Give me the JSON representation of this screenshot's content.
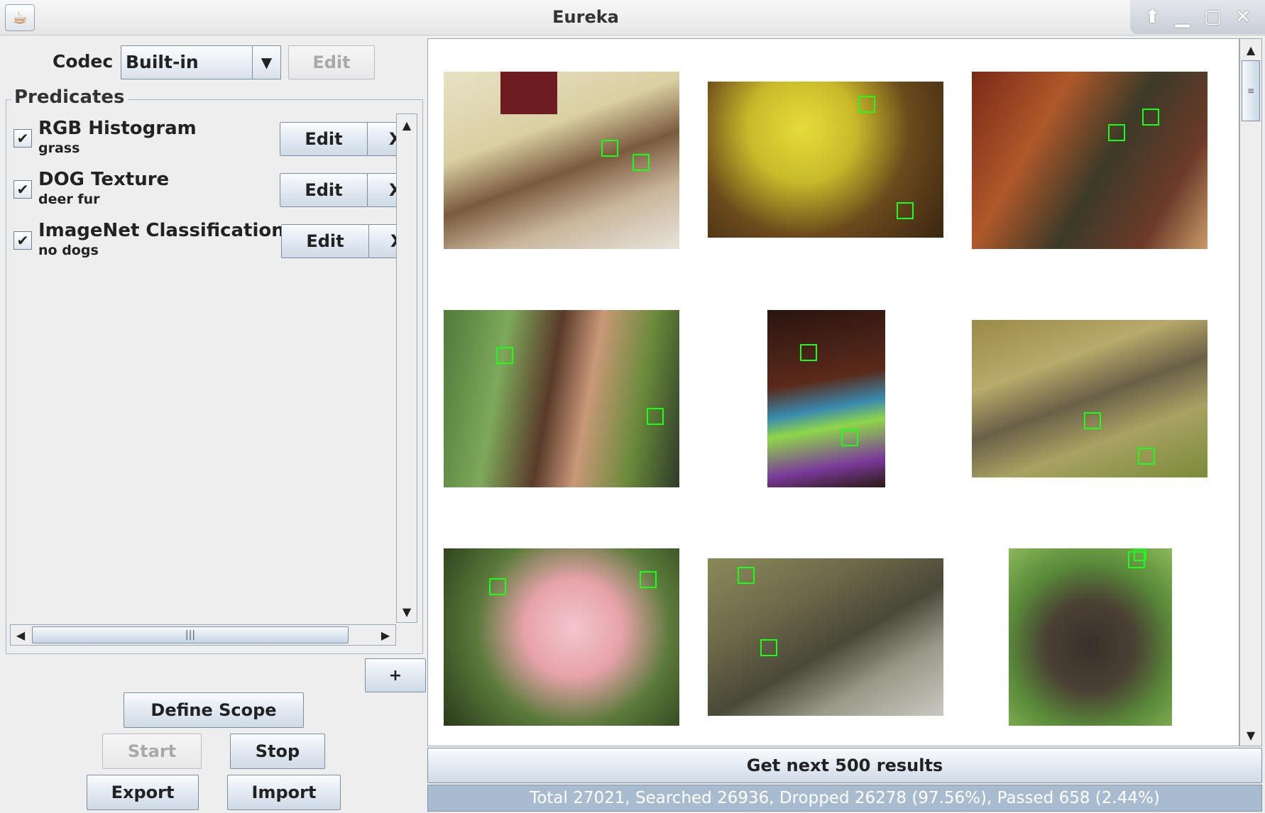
{
  "window": {
    "title": "Eureka",
    "app_icon": "java-cup-icon",
    "controls": [
      "arrow-up-icon",
      "minimize-icon",
      "maximize-icon",
      "close-icon"
    ]
  },
  "codec": {
    "label": "Codec",
    "selected": "Built-in",
    "edit_label": "Edit"
  },
  "predicates": {
    "title": "Predicates",
    "items": [
      {
        "name": "RGB Histogram",
        "sub": "grass",
        "checked": true,
        "edit_label": "Edit",
        "remove_label": "X"
      },
      {
        "name": "DOG Texture",
        "sub": "deer fur",
        "checked": true,
        "edit_label": "Edit",
        "remove_label": "X"
      },
      {
        "name": "ImageNet Classification",
        "sub": "no dogs",
        "checked": true,
        "edit_label": "Edit",
        "remove_label": "X"
      }
    ],
    "add_label": "+"
  },
  "actions": {
    "define_scope": "Define Scope",
    "start": "Start",
    "stop": "Stop",
    "export": "Export",
    "import": "Import"
  },
  "results": {
    "next_label": "Get next 500 results",
    "status": "Total 27021, Searched 26936, Dropped 26278 (97.56%), Passed 658 (2.44%)"
  },
  "colors": {
    "roi_box": "#1cff1c",
    "button_border": "#7d8ea3",
    "status_bg": "#a9bccf"
  }
}
